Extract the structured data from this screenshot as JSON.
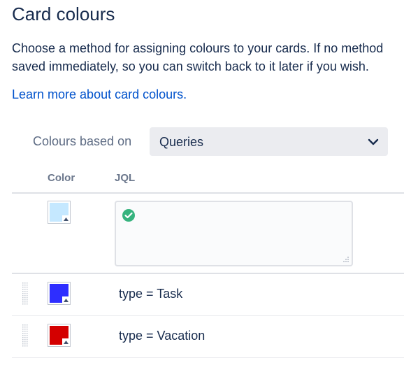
{
  "header": {
    "title": "Card colours",
    "description_line1": "Choose a method for assigning colours to your cards. If no method",
    "description_line2": "saved immediately, so you can switch back to it later if you wish.",
    "learn_more_link": "Learn more about card colours."
  },
  "method": {
    "label": "Colours based on",
    "selected": "Queries"
  },
  "table": {
    "headers": {
      "color": "Color",
      "jql": "JQL"
    },
    "new_row": {
      "color": "#c5e8ff",
      "jql_value": "",
      "valid": true
    },
    "rows": [
      {
        "color": "#2e2eff",
        "jql": "type = Task"
      },
      {
        "color": "#d40000",
        "jql": "type = Vacation"
      }
    ]
  },
  "colors": {
    "text": "#172b4d",
    "link": "#0052cc",
    "muted": "#5e6c84",
    "select_bg": "#ebecf0",
    "valid_check": "#36b37e"
  }
}
